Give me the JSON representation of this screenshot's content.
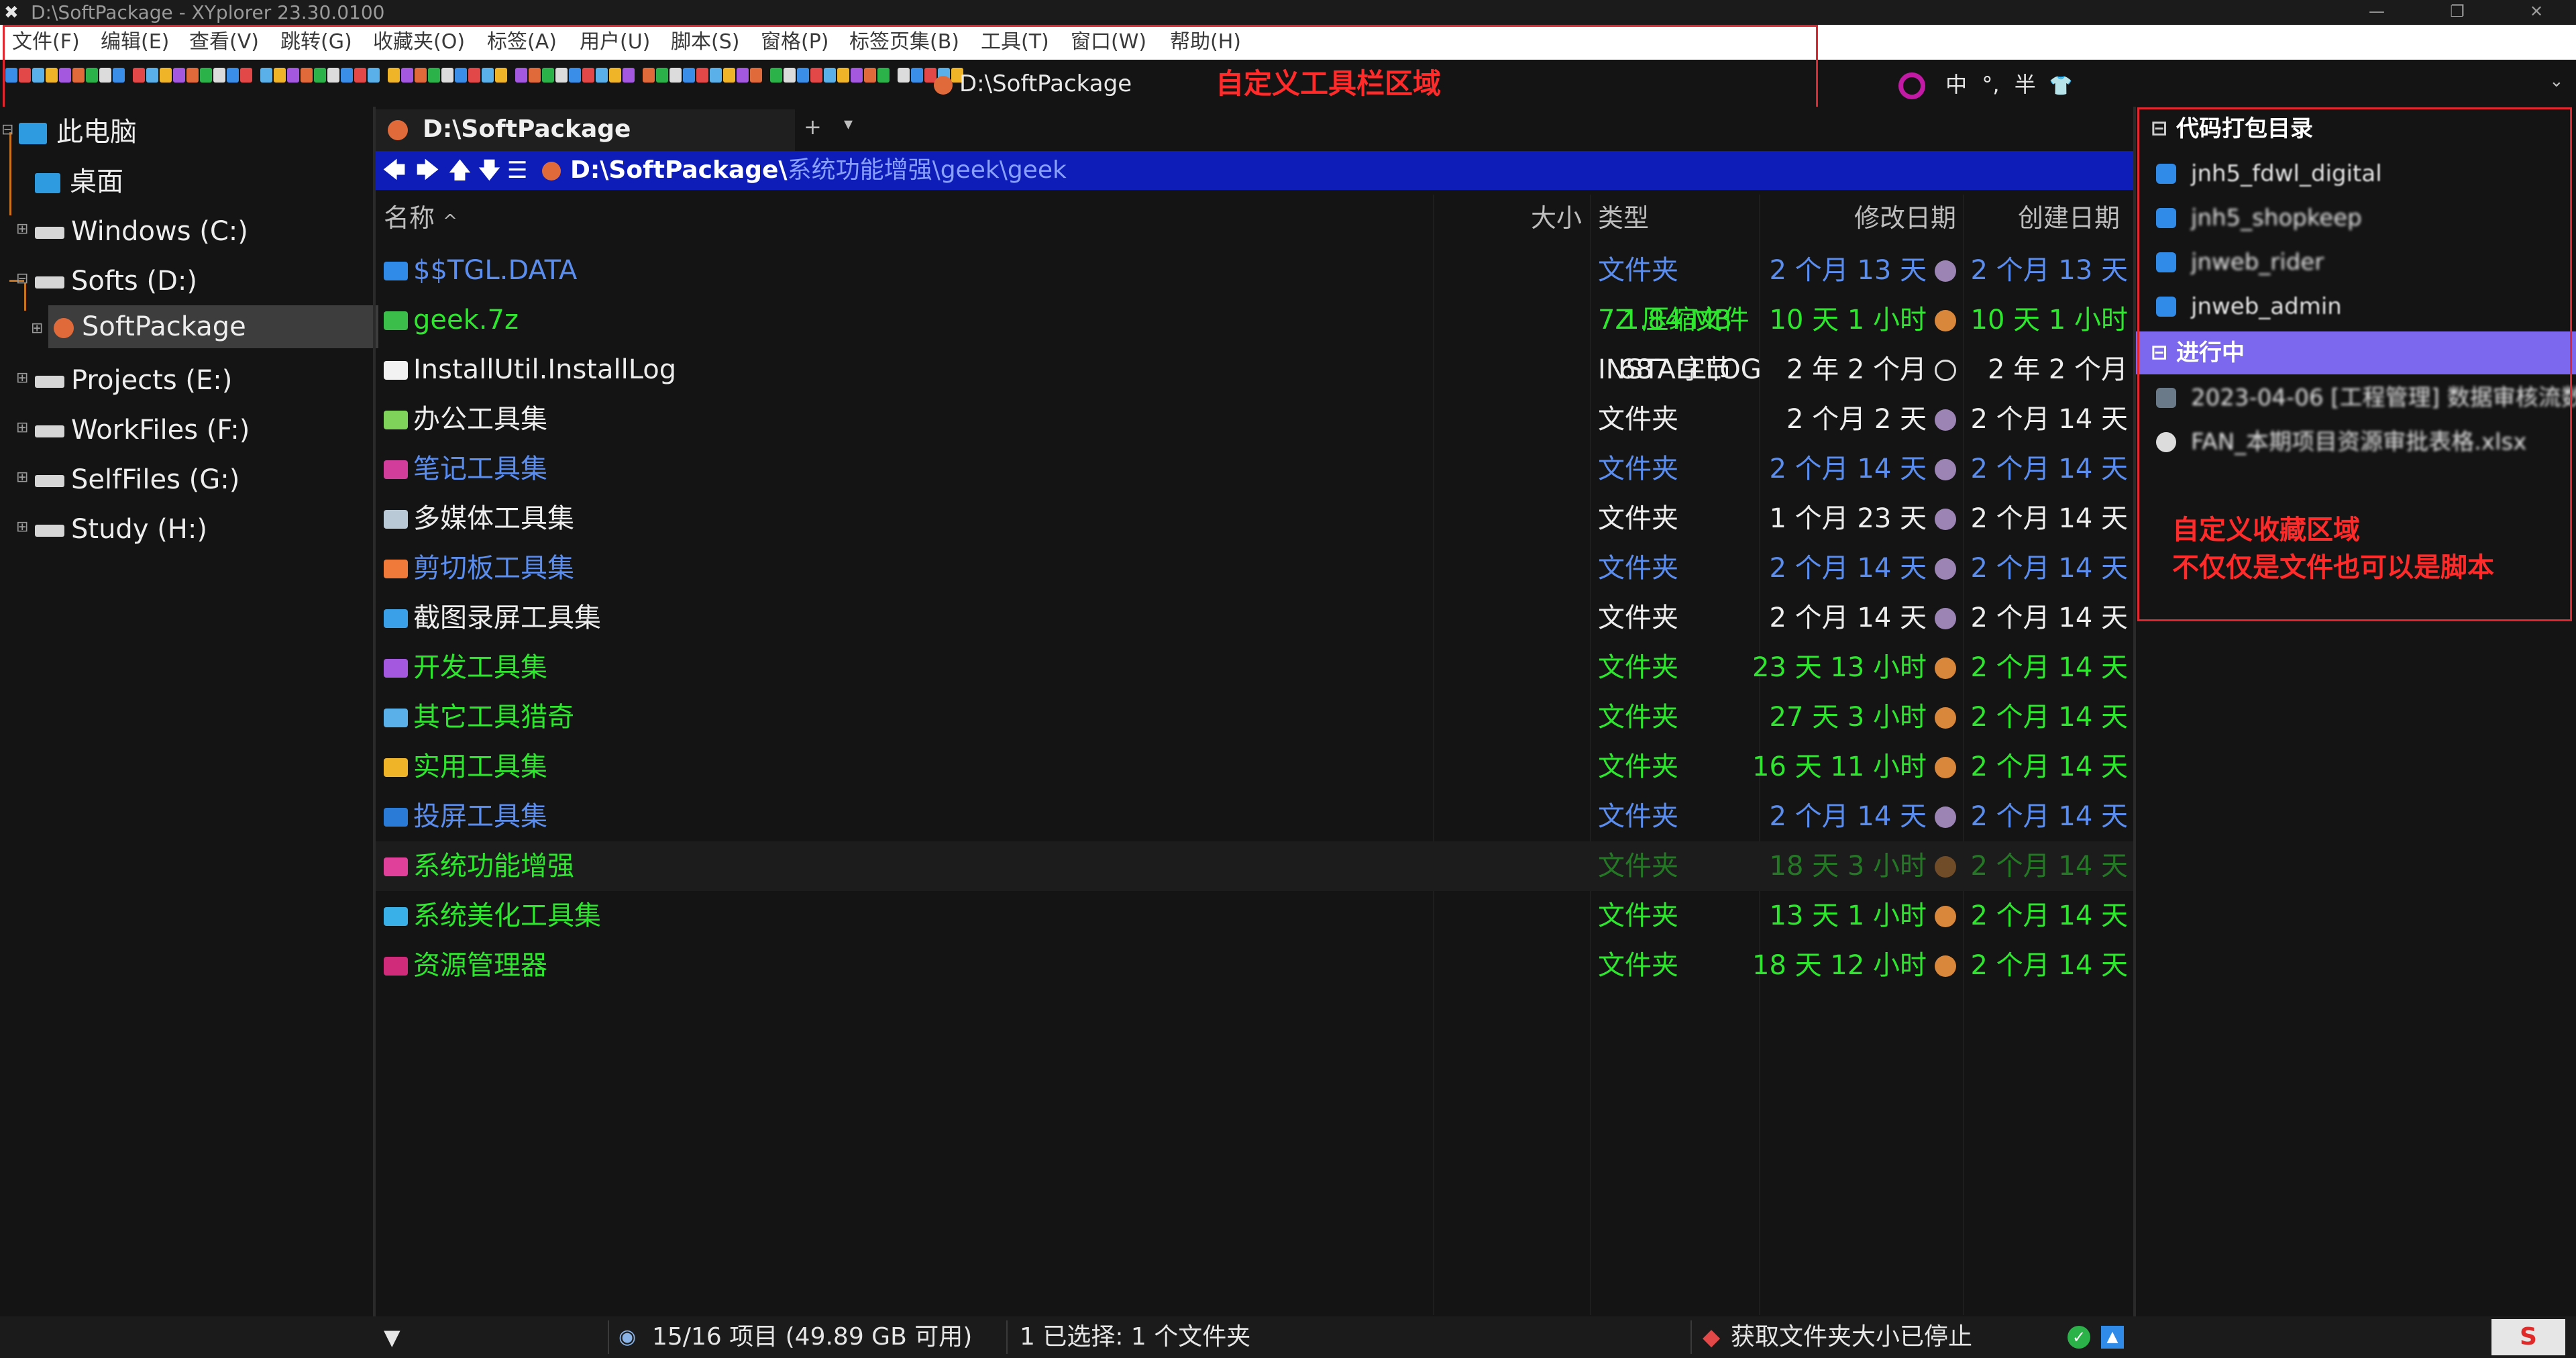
{
  "window": {
    "title": "D:\\SoftPackage - XYplorer 23.30.0100",
    "logo": "✖"
  },
  "menu": [
    "文件(F)",
    "编辑(E)",
    "查看(V)",
    "跳转(G)",
    "收藏夹(O)",
    "标签(A)",
    "用户(U)",
    "脚本(S)",
    "窗格(P)",
    "标签页集(B)",
    "工具(T)",
    "窗口(W)",
    "帮助(H)"
  ],
  "toolbar": {
    "path": "D:\\SoftPackage"
  },
  "annotations": {
    "toolbar_region": "自定义工具栏区域",
    "catalog_line1": "自定义收藏区域",
    "catalog_line2": "不仅仅是文件也可以是脚本"
  },
  "ime": {
    "lang": "中",
    "punct": "°,",
    "width": "半",
    "skin": "👕"
  },
  "tree": [
    {
      "label": "此电脑",
      "icon": "pc-icon"
    },
    {
      "label": "桌面",
      "icon": "desktop-icon"
    },
    {
      "label": "Windows (C:)",
      "icon": "drive-icon"
    },
    {
      "label": "Softs (D:)",
      "icon": "drive-icon"
    },
    {
      "label": "SoftPackage",
      "icon": "folder-icon"
    },
    {
      "label": "Projects (E:)",
      "icon": "drive-icon"
    },
    {
      "label": "WorkFiles (F:)",
      "icon": "drive-icon"
    },
    {
      "label": "SelfFiles (G:)",
      "icon": "drive-icon"
    },
    {
      "label": "Study (H:)",
      "icon": "drive-icon"
    }
  ],
  "tab": {
    "label": "D:\\SoftPackage",
    "plus": "+",
    "dropdown": "▾"
  },
  "address": {
    "root": "D:\\SoftPackage\\",
    "rest": "系统功能增强\\geek\\geek"
  },
  "columns": {
    "name": "名称",
    "size": "大小",
    "type": "类型",
    "modified": "修改日期",
    "created": "创建日期"
  },
  "files": [
    {
      "name": "$$TGL.DATA",
      "size": "",
      "type": "文件夹",
      "modified": "2 个月 13 天",
      "created": "2 个月 13 天",
      "color": "#5b8dee",
      "dot": "#9c84b5",
      "icon_color": "#2f8ae8"
    },
    {
      "name": "geek.7z",
      "size": "1.84 MB",
      "type": "7Z 压缩文件",
      "modified": "10 天 1 小时",
      "created": "10 天 1 小时",
      "color": "#2ee62e",
      "dot": "#d9873a",
      "icon_color": "#3bbf4a"
    },
    {
      "name": "InstallUtil.InstallLog",
      "size": "687 字节",
      "type": "INSTALLLOG",
      "modified": "2 年 2 个月",
      "created": "2 年 2 个月",
      "color": "#ededed",
      "dot": "none",
      "icon_color": "#f2f2f2"
    },
    {
      "name": "办公工具集",
      "size": "",
      "type": "文件夹",
      "modified": "2 个月 2 天",
      "created": "2 个月 14 天",
      "color": "#ededed",
      "dot": "#9c84b5",
      "icon_color": "#7fd35a"
    },
    {
      "name": "笔记工具集",
      "size": "",
      "type": "文件夹",
      "modified": "2 个月 14 天",
      "created": "2 个月 14 天",
      "color": "#5b8dee",
      "dot": "#9c84b5",
      "icon_color": "#d23c9a"
    },
    {
      "name": "多媒体工具集",
      "size": "",
      "type": "文件夹",
      "modified": "1 个月 23 天",
      "created": "2 个月 14 天",
      "color": "#ededed",
      "dot": "#9c84b5",
      "icon_color": "#b9c9d6"
    },
    {
      "name": "剪切板工具集",
      "size": "",
      "type": "文件夹",
      "modified": "2 个月 14 天",
      "created": "2 个月 14 天",
      "color": "#5b8dee",
      "dot": "#9c84b5",
      "icon_color": "#f07a3a"
    },
    {
      "name": "截图录屏工具集",
      "size": "",
      "type": "文件夹",
      "modified": "2 个月 14 天",
      "created": "2 个月 14 天",
      "color": "#ededed",
      "dot": "#9c84b5",
      "icon_color": "#3aa0e8"
    },
    {
      "name": "开发工具集",
      "size": "",
      "type": "文件夹",
      "modified": "23 天 13 小时",
      "created": "2 个月 14 天",
      "color": "#2ee62e",
      "dot": "#d9873a",
      "icon_color": "#a458e0"
    },
    {
      "name": "其它工具猎奇",
      "size": "",
      "type": "文件夹",
      "modified": "27 天 3 小时",
      "created": "2 个月 14 天",
      "color": "#2ee62e",
      "dot": "#d9873a",
      "icon_color": "#5ab0e8"
    },
    {
      "name": "实用工具集",
      "size": "",
      "type": "文件夹",
      "modified": "16 天 11 小时",
      "created": "2 个月 14 天",
      "color": "#2ee62e",
      "dot": "#d9873a",
      "icon_color": "#f0b428"
    },
    {
      "name": "投屏工具集",
      "size": "",
      "type": "文件夹",
      "modified": "2 个月 14 天",
      "created": "2 个月 14 天",
      "color": "#5b8dee",
      "dot": "#9c84b5",
      "icon_color": "#2a7ad8"
    },
    {
      "name": "系统功能增强",
      "size": "",
      "type": "文件夹",
      "modified": "18 天 3 小时",
      "created": "2 个月 14 天",
      "color": "#2ee62e",
      "dot": "#d9873a",
      "icon_color": "#e0409a",
      "dim": true
    },
    {
      "name": "系统美化工具集",
      "size": "",
      "type": "文件夹",
      "modified": "13 天 1 小时",
      "created": "2 个月 14 天",
      "color": "#2ee62e",
      "dot": "#d9873a",
      "icon_color": "#3ab0e8"
    },
    {
      "name": "资源管理器",
      "size": "",
      "type": "文件夹",
      "modified": "18 天 12 小时",
      "created": "2 个月 14 天",
      "color": "#2ee62e",
      "dot": "#d9873a",
      "icon_color": "#d02a7a"
    }
  ],
  "catalog": {
    "group1": "代码打包目录",
    "group1_items": [
      "jnh5_fdwl_digital",
      "jnh5_shopkeep",
      "jnweb_rider",
      "jnweb_admin"
    ],
    "group2": "进行中",
    "group2_items": [
      "2023-04-06 [工程管理] 数据审核流数...",
      "FAN_本期项目资源审批表格.xlsx"
    ]
  },
  "status": {
    "items": "15/16 项目 (49.89 GB 可用)",
    "selected": "1 已选择: 1 个文件夹",
    "task": "获取文件夹大小已停止"
  },
  "colors": {
    "accent_blue": "#0e1db8",
    "annotation_red": "#e0262e",
    "catalog_selected": "#7b68ee"
  }
}
